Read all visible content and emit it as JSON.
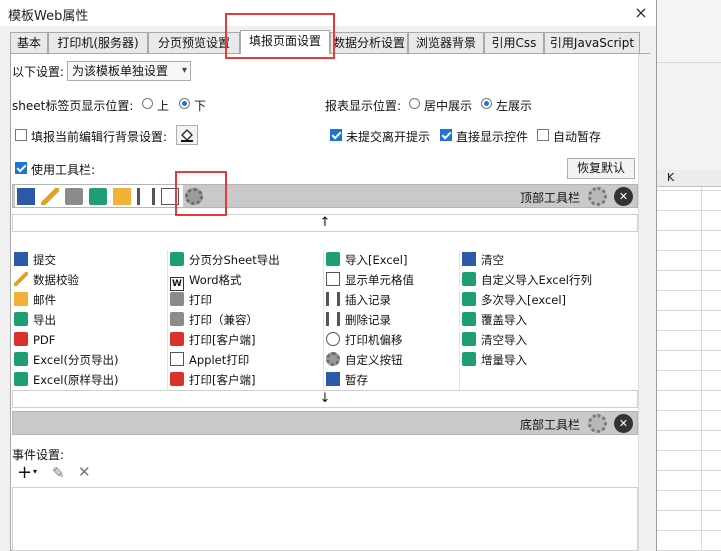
{
  "window": {
    "title": "模板Web属性",
    "close_glyph": "×"
  },
  "tabs": [
    {
      "label": "基本"
    },
    {
      "label": "打印机(服务器)"
    },
    {
      "label": "分页预览设置"
    },
    {
      "label": "填报页面设置",
      "active": true
    },
    {
      "label": "数据分析设置"
    },
    {
      "label": "浏览器背景"
    },
    {
      "label": "引用Css"
    },
    {
      "label": "引用JavaScript"
    }
  ],
  "settings": {
    "scope_label": "以下设置:",
    "scope_value": "为该模板单独设置",
    "sheet_tab_label": "sheet标签页显示位置:",
    "sheet_tab_top": "上",
    "sheet_tab_bottom": "下",
    "report_pos_label": "报表显示位置:",
    "report_pos_center": "居中展示",
    "report_pos_left": "左展示",
    "fill_bg_label": "填报当前编辑行背景设置:",
    "unsubmit_label": "未提交离开提示",
    "direct_ctrl_label": "直接显示控件",
    "autosave_label": "自动暂存",
    "use_toolbar_label": "使用工具栏:",
    "restore_default": "恢复默认"
  },
  "top_toolbar": {
    "label": "顶部工具栏"
  },
  "bottom_toolbar": {
    "label": "底部工具栏"
  },
  "arrows": {
    "up": "↑",
    "down": "↓"
  },
  "buttons": [
    [
      "提交",
      "分页分Sheet导出",
      "导入[Excel]",
      "清空"
    ],
    [
      "数据校验",
      "Word格式",
      "显示单元格值",
      "自定义导入Excel行列"
    ],
    [
      "邮件",
      "打印",
      "插入记录",
      "多次导入[excel]"
    ],
    [
      "导出",
      "打印（兼容）",
      "删除记录",
      "覆盖导入"
    ],
    [
      "PDF",
      "打印[客户端]",
      "打印机偏移",
      "清空导入"
    ],
    [
      "Excel(分页导出)",
      "Applet打印",
      "自定义按钮",
      "增量导入"
    ],
    [
      "Excel(原样导出)",
      "打印[客户端]",
      "暂存",
      ""
    ]
  ],
  "events": {
    "label": "事件设置:",
    "add_glyph": "+",
    "edit_glyph": "✎",
    "delete_glyph": "✕"
  },
  "background_sheet": {
    "col_label": "K"
  }
}
